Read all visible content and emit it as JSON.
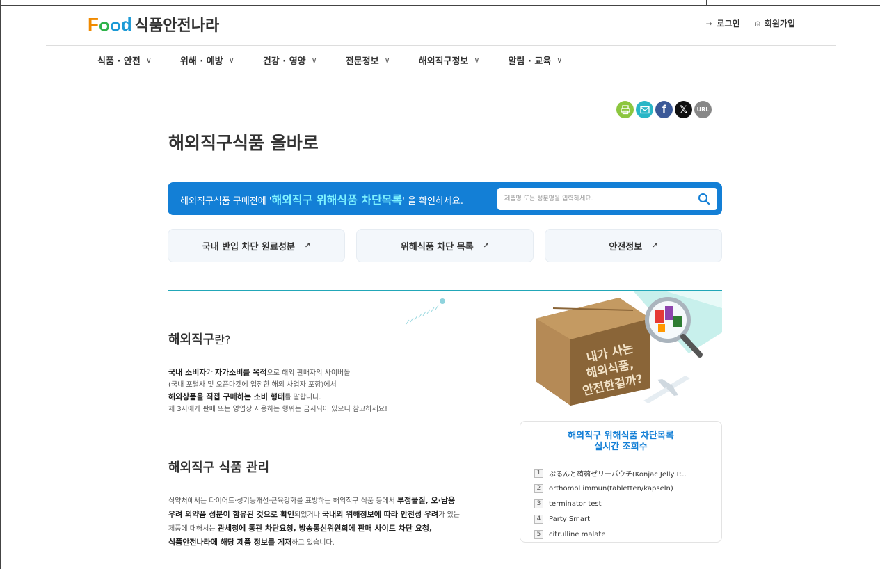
{
  "header": {
    "logo_brand": "d",
    "logo_brand_f": "F",
    "logo_text": "식품안전나라",
    "login_label": "로그인",
    "signup_label": "회원가입"
  },
  "nav": {
    "items": [
      {
        "label": "식품 · 안전"
      },
      {
        "label": "위해 · 예방"
      },
      {
        "label": "건강 · 영양"
      },
      {
        "label": "전문정보"
      },
      {
        "label": "해외직구정보"
      },
      {
        "label": "알림 · 교육"
      }
    ]
  },
  "share": {
    "url_label": "URL",
    "colors": {
      "print": "#8cc63f",
      "email": "#29b6c6",
      "facebook": "#3b5998",
      "x": "#111111",
      "url": "#888888"
    }
  },
  "page": {
    "title": "해외직구식품 올바로"
  },
  "search": {
    "message_pre": "해외직구식품 구매전에 '",
    "message_highlight": "해외직구 위해식품 차단목록",
    "message_post": "' 을 확인하세요.",
    "placeholder": "제품명 또는 성분명을 입력하세요."
  },
  "quick_links": [
    {
      "label": "국내 반입 차단 원료성분"
    },
    {
      "label": "위해식품 차단 목록"
    },
    {
      "label": "안전정보"
    }
  ],
  "hero": {
    "box_text_1": "내가 사는",
    "box_text_2": "해외식품,",
    "box_text_3": "안전한걸까?"
  },
  "section1": {
    "title_bold": "해외직구",
    "title_light": "란?",
    "line1_b1": "국내 소비자",
    "line1_t1": "가 ",
    "line1_b2": "자가소비를 목적",
    "line1_t2": "으로 해외 판매자의 사이버몰",
    "line2": "(국내 포털사 및 오픈마켓에 입점한 해외 사업자 포함)에서",
    "line3_b": "해외상품을 직접 구매하는 소비 형태",
    "line3_t": "를 말합니다.",
    "line4": "제 3자에게 판매 또는 영업상 사용하는 행위는 금지되어 있으니 참고하세요!"
  },
  "section2": {
    "title": "해외직구 식품 관리",
    "p1": "식약처에서는 다이어트·성기능개선·근육강화를 표방하는 해외직구 식품 등에서 ",
    "b1": "부정물질, 오·남용",
    "b2": "우려 의약품 성분이 함유된 것으로 확인",
    "p2": "되었거나 ",
    "b3": "국내외 위해정보에 따라 안전성 우려",
    "p3": "가 있는",
    "p4": "제품에 대해서는 ",
    "b4": "관세청에 통관 차단요청, 방송통신위원회에 판매 사이트 차단 요청,",
    "b5": "식품안전나라에 해당 제품 정보를 게재",
    "p5": "하고 있습니다."
  },
  "ranking": {
    "title_line1": "해외직구 위해식품 차단목록",
    "title_line2": "실시간 조회수",
    "items": [
      {
        "rank": "1",
        "name": "ぷるんと蒟蒻ゼリーパウチ(Konjac Jelly P..."
      },
      {
        "rank": "2",
        "name": "orthomol immun(tabletten/kapseln)"
      },
      {
        "rank": "3",
        "name": "terminator test"
      },
      {
        "rank": "4",
        "name": "Party Smart"
      },
      {
        "rank": "5",
        "name": "citrulline malate"
      }
    ]
  }
}
